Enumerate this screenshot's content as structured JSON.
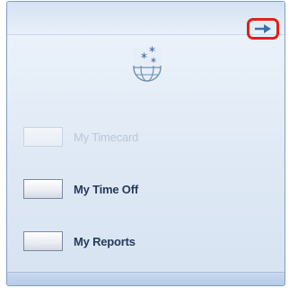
{
  "panel": {
    "expand_icon": "arrow-right-icon",
    "logo_icon": "globe-stars-icon",
    "accent_color": "#e0201a"
  },
  "nav": {
    "items": [
      {
        "label": "My Timecard",
        "state": "disabled"
      },
      {
        "label": "My Time Off",
        "state": "enabled"
      },
      {
        "label": "My Reports",
        "state": "enabled"
      }
    ]
  }
}
